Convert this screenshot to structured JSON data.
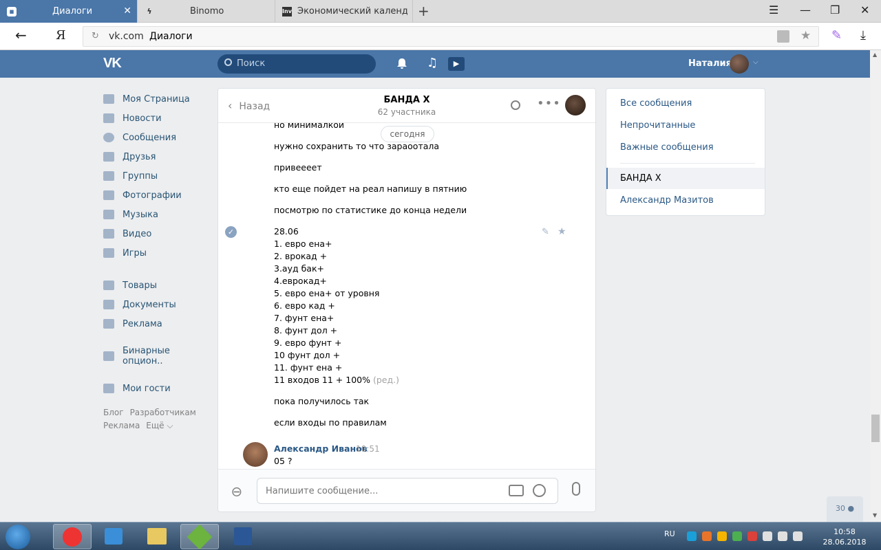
{
  "browser": {
    "tabs": [
      {
        "label": "Диалоги",
        "active": true
      },
      {
        "label": "Binomo",
        "active": false
      },
      {
        "label": "Экономический календарь",
        "active": false
      }
    ],
    "address": {
      "domain": "vk.com",
      "title": "Диалоги"
    }
  },
  "vk_header": {
    "logo": "VK",
    "search_placeholder": "Поиск",
    "user_name": "Наталия"
  },
  "left_nav": {
    "items": [
      {
        "label": "Моя Страница"
      },
      {
        "label": "Новости"
      },
      {
        "label": "Сообщения"
      },
      {
        "label": "Друзья"
      },
      {
        "label": "Группы"
      },
      {
        "label": "Фотографии"
      },
      {
        "label": "Музыка"
      },
      {
        "label": "Видео"
      },
      {
        "label": "Игры"
      },
      {
        "label": "Товары"
      },
      {
        "label": "Документы"
      },
      {
        "label": "Реклама"
      },
      {
        "label": "Бинарные опцион.."
      },
      {
        "label": "Мои гости"
      }
    ],
    "footer": {
      "blog": "Блог",
      "developers": "Разработчикам",
      "ads": "Реклама",
      "more": "Ещё ⌵"
    }
  },
  "chat": {
    "back_label": "Назад",
    "title": "БАНДА X",
    "subtitle": "62 участника",
    "date_pill": "сегодня",
    "messages": [
      "но минималкой",
      "нужно сохранить то что зараоотала",
      "привеееет",
      "кто еще пойдет на реал напишу в пятнию",
      "посмотрю по статистике до конца недели",
      "28.06",
      "1. евро ена+",
      "2. врокад +",
      "3.ауд бак+",
      "4.еврокад+",
      "5. евро ена+ от уровня",
      "6. евро кад +",
      "7. фунт ена+",
      "8. фунт дол +",
      "9. евро фунт +",
      "10 фунт дол +",
      "11. фунт ена +",
      "11 входов 11 + 100%",
      "пока получилось так",
      "если входы по правилам"
    ],
    "edited_label": "(ред.)",
    "last_sender": {
      "name": "Александр Иванов",
      "time": "10:51",
      "text": "05 ?"
    },
    "input_placeholder": "Напишите сообщение..."
  },
  "right_panel": {
    "all": "Все сообщения",
    "unread": "Непрочитанные",
    "important": "Важные сообщения",
    "active_chat": "БАНДА X",
    "other_chat": "Александр Мазитов"
  },
  "online_count": "30",
  "taskbar": {
    "lang": "RU",
    "time": "10:58",
    "date": "28.06.2018"
  },
  "colors": {
    "vk_blue": "#4a76a8",
    "link": "#2a5885",
    "background": "#edeef0"
  }
}
